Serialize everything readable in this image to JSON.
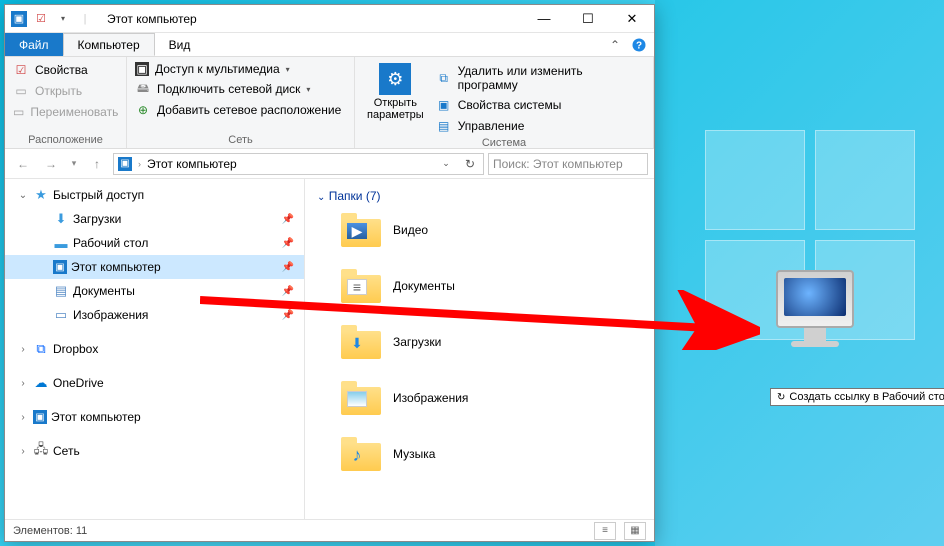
{
  "window": {
    "title": "Этот компьютер"
  },
  "tabs": {
    "file": "Файл",
    "computer": "Компьютер",
    "view": "Вид"
  },
  "ribbon": {
    "location": {
      "properties": "Свойства",
      "open": "Открыть",
      "rename": "Переименовать",
      "group": "Расположение"
    },
    "network": {
      "media": "Доступ к мультимедиа",
      "map_drive": "Подключить сетевой диск",
      "add_location": "Добавить сетевое расположение",
      "group": "Сеть"
    },
    "system": {
      "settings_line1": "Открыть",
      "settings_line2": "параметры",
      "uninstall": "Удалить или изменить программу",
      "sys_props": "Свойства системы",
      "manage": "Управление",
      "group": "Система"
    }
  },
  "address": {
    "path": "Этот компьютер",
    "search_placeholder": "Поиск: Этот компьютер"
  },
  "tree": {
    "quick_access": "Быстрый доступ",
    "downloads": "Загрузки",
    "desktop": "Рабочий стол",
    "this_pc": "Этот компьютер",
    "documents": "Документы",
    "pictures": "Изображения",
    "dropbox": "Dropbox",
    "onedrive": "OneDrive",
    "this_pc2": "Этот компьютер",
    "network": "Сеть"
  },
  "content": {
    "folders_header": "Папки (7)",
    "videos": "Видео",
    "documents": "Документы",
    "downloads": "Загрузки",
    "pictures": "Изображения",
    "music": "Музыка"
  },
  "status": {
    "items": "Элементов: 11"
  },
  "tooltip": {
    "text": "Создать ссылку в Рабочий стол"
  }
}
